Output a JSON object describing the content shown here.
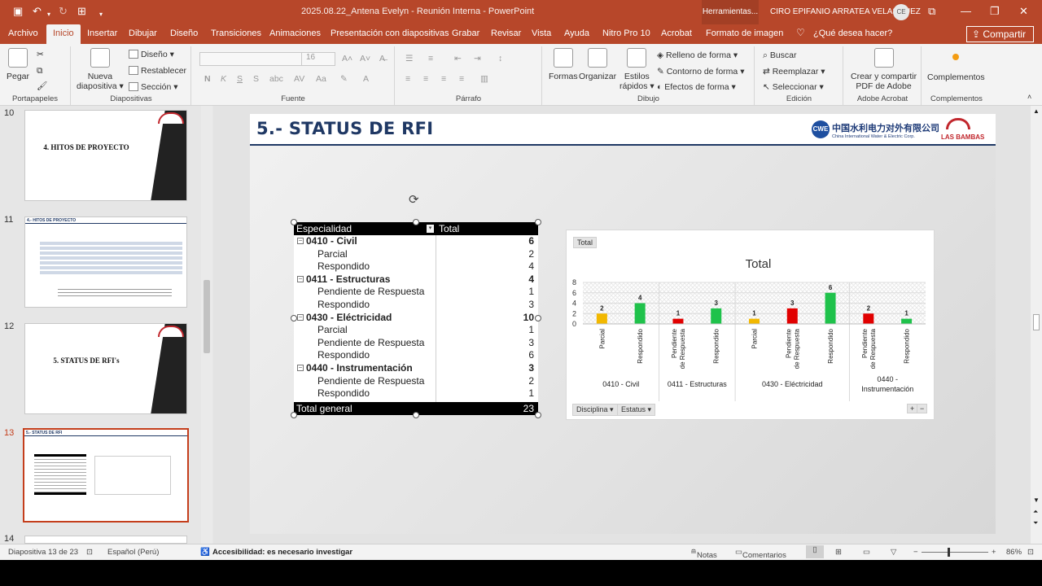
{
  "window": {
    "doc_title": "2025.08.22_Antena Evelyn - Reunión Interna  -  PowerPoint",
    "context_tools": "Herramientas...",
    "user_name": "CIRO EPIFANIO ARRATEA VELASQUEZ",
    "user_initials": "CE"
  },
  "tabs": [
    "Archivo",
    "Inicio",
    "Insertar",
    "Dibujar",
    "Diseño",
    "Transiciones",
    "Animaciones",
    "Presentación con diapositivas",
    "Grabar",
    "Revisar",
    "Vista",
    "Ayuda",
    "Nitro Pro 10",
    "Acrobat",
    "Formato de imagen"
  ],
  "tell_me": "¿Qué desea hacer?",
  "share": "Compartir",
  "ribbon": {
    "portapapeles": {
      "label": "Portapapeles",
      "pegar": "Pegar"
    },
    "diapositivas": {
      "label": "Diapositivas",
      "nueva": "Nueva",
      "diapositiva": "diapositiva",
      "diseno": "Diseño",
      "restablecer": "Restablecer",
      "seccion": "Sección"
    },
    "fuente": {
      "label": "Fuente",
      "size": "16",
      "n": "N",
      "k": "K",
      "s": "S",
      "s2": "S"
    },
    "parrafo": {
      "label": "Párrafo"
    },
    "dibujo": {
      "label": "Dibujo",
      "formas": "Formas",
      "organizar": "Organizar",
      "estilos": "Estilos",
      "rapidos": "rápidos",
      "relleno": "Relleno de forma",
      "contorno": "Contorno de forma",
      "efectos": "Efectos de forma"
    },
    "edicion": {
      "label": "Edición",
      "buscar": "Buscar",
      "reemplazar": "Reemplazar",
      "seleccionar": "Seleccionar"
    },
    "adobe": {
      "label": "Adobe Acrobat",
      "crear": "Crear y compartir",
      "pdf": "PDF de Adobe"
    },
    "complementos": {
      "label": "Complementos",
      "btn": "Complementos"
    }
  },
  "thumbnails": [
    {
      "num": "10",
      "title": "4. HITOS DE PROYECTO"
    },
    {
      "num": "11",
      "title": "4.- HITOS DE PROYECTO"
    },
    {
      "num": "12",
      "title": "5. STATUS DE RFI's"
    },
    {
      "num": "13",
      "title": "5.- STATUS DE RFI"
    },
    {
      "num": "14",
      "title": ""
    }
  ],
  "slide": {
    "title": "5.- STATUS DE RFI",
    "logo_cn": "中国水利电力对外有限公司",
    "logo_en": "China International Water & Electric Corp.",
    "logo_cw_mark": "CWE",
    "logo_lb": "LAS BAMBAS"
  },
  "pivot": {
    "col1": "Especialidad",
    "col2": "Total",
    "rows": [
      {
        "label": "0410 - Civil",
        "value": "6",
        "level": 0
      },
      {
        "label": "Parcial",
        "value": "2",
        "level": 1
      },
      {
        "label": "Respondido",
        "value": "4",
        "level": 1
      },
      {
        "label": "0411 - Estructuras",
        "value": "4",
        "level": 0
      },
      {
        "label": "Pendiente de Respuesta",
        "value": "1",
        "level": 1
      },
      {
        "label": "Respondido",
        "value": "3",
        "level": 1
      },
      {
        "label": "0430 - Eléctricidad",
        "value": "10",
        "level": 0
      },
      {
        "label": "Parcial",
        "value": "1",
        "level": 1
      },
      {
        "label": "Pendiente de Respuesta",
        "value": "3",
        "level": 1
      },
      {
        "label": "Respondido",
        "value": "6",
        "level": 1
      },
      {
        "label": "0440 - Instrumentación",
        "value": "3",
        "level": 0
      },
      {
        "label": "Pendiente de Respuesta",
        "value": "2",
        "level": 1
      },
      {
        "label": "Respondido",
        "value": "1",
        "level": 1
      }
    ],
    "total_label": "Total general",
    "total_value": "23"
  },
  "chart_data": {
    "type": "bar",
    "title": "Total",
    "field_button": "Total",
    "groups": [
      {
        "name": "0410 - Civil",
        "bars": [
          {
            "label": "Parcial",
            "value": 2,
            "color": "#f2b800"
          },
          {
            "label": "Respondido",
            "value": 4,
            "color": "#1fc24b"
          }
        ]
      },
      {
        "name": "0411 - Estructuras",
        "bars": [
          {
            "label": "Pendiente de Respuesta",
            "value": 1,
            "color": "#e10000"
          },
          {
            "label": "Respondido",
            "value": 3,
            "color": "#1fc24b"
          }
        ]
      },
      {
        "name": "0430 - Eléctricidad",
        "bars": [
          {
            "label": "Parcial",
            "value": 1,
            "color": "#f2b800"
          },
          {
            "label": "Pendiente de Respuesta",
            "value": 3,
            "color": "#e10000"
          },
          {
            "label": "Respondido",
            "value": 6,
            "color": "#1fc24b"
          }
        ]
      },
      {
        "name": "0440 - Instrumentación",
        "bars": [
          {
            "label": "Pendiente de Respuesta",
            "value": 2,
            "color": "#e10000"
          },
          {
            "label": "Respondido",
            "value": 1,
            "color": "#1fc24b"
          }
        ]
      }
    ],
    "yticks": [
      0,
      2,
      4,
      6,
      8
    ],
    "ylim": [
      0,
      8
    ],
    "grid": true,
    "axis_buttons": [
      "Disciplina",
      "Estatus"
    ]
  },
  "status": {
    "slide_of": "Diapositiva 13 de 23",
    "language": "Español (Perú)",
    "accessibility": "Accesibilidad: es necesario investigar",
    "notes": "Notas",
    "comments": "Comentarios",
    "zoom": "86%"
  }
}
